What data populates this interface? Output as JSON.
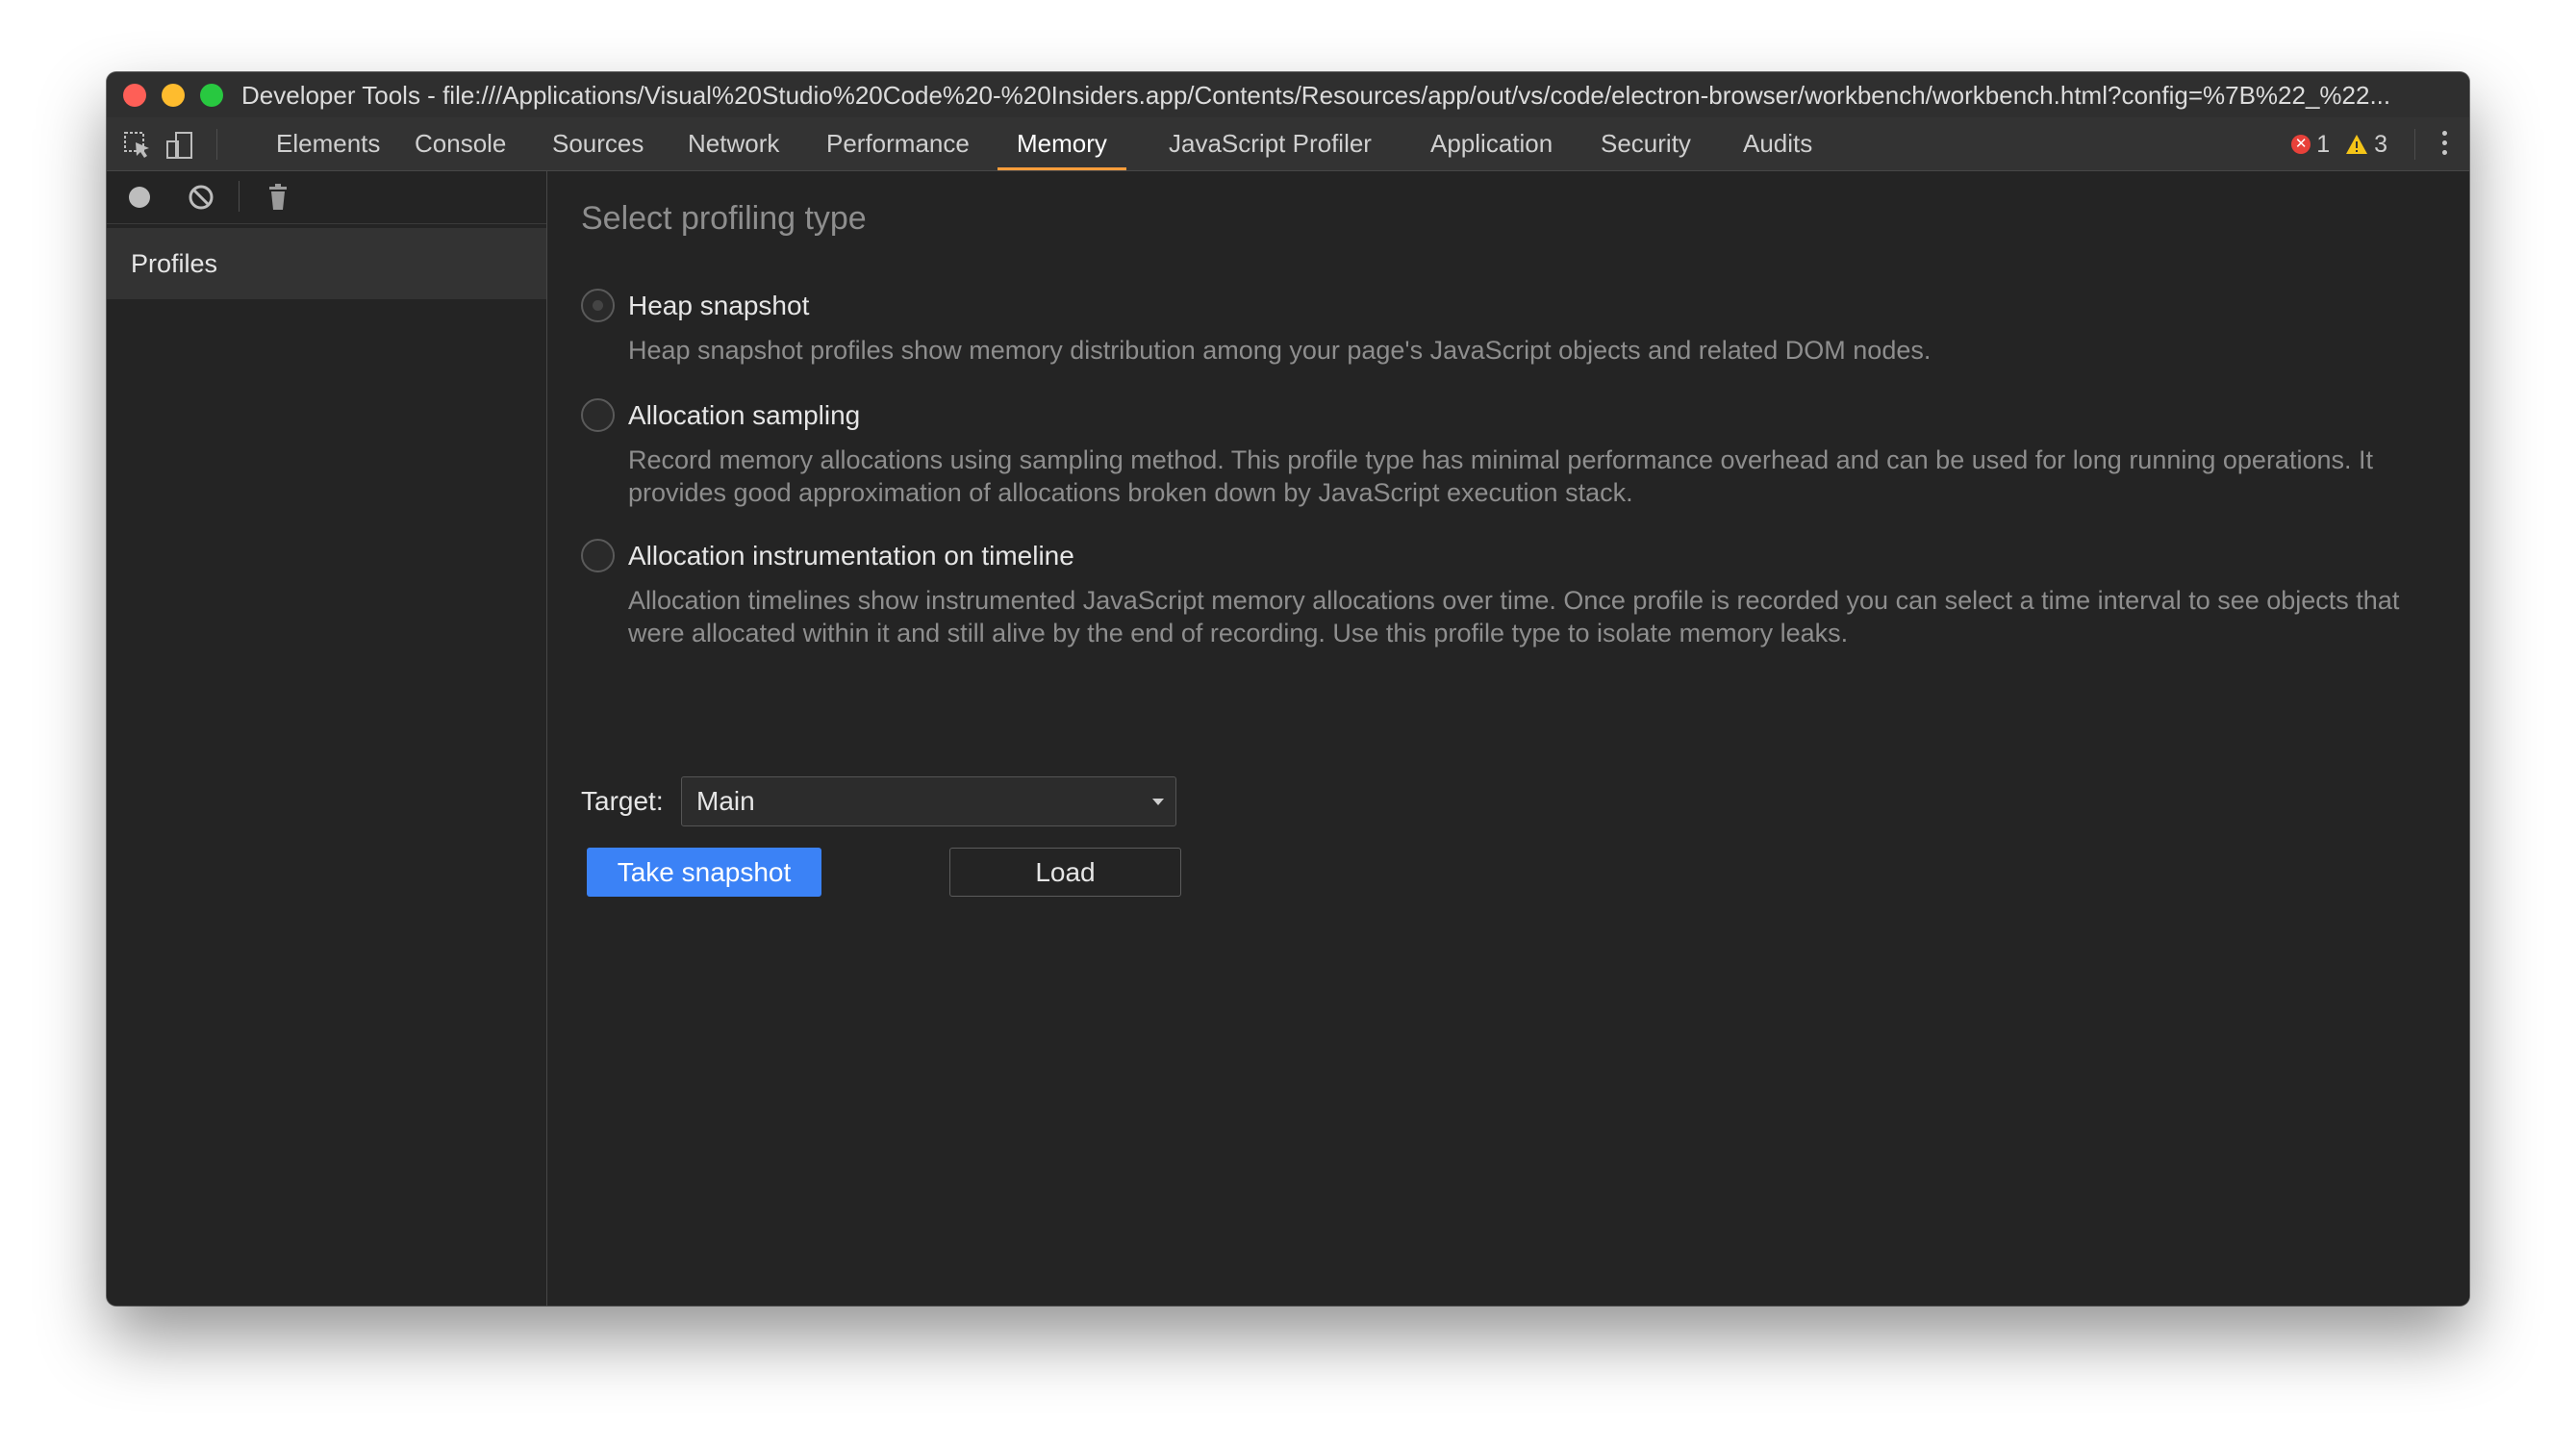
{
  "window": {
    "title": "Developer Tools - file:///Applications/Visual%20Studio%20Code%20-%20Insiders.app/Contents/Resources/app/out/vs/code/electron-browser/workbench/workbench.html?config=%7B%22_%22..."
  },
  "toolbar": {
    "icons": [
      "inspect-element-icon",
      "device-toolbar-icon"
    ],
    "tabs": [
      {
        "label": "Elements",
        "active": false
      },
      {
        "label": "Console",
        "active": false
      },
      {
        "label": "Sources",
        "active": false
      },
      {
        "label": "Network",
        "active": false
      },
      {
        "label": "Performance",
        "active": false
      },
      {
        "label": "Memory",
        "active": true
      },
      {
        "label": "JavaScript Profiler",
        "active": false
      },
      {
        "label": "Application",
        "active": false
      },
      {
        "label": "Security",
        "active": false
      },
      {
        "label": "Audits",
        "active": false
      }
    ],
    "error_count": "1",
    "warning_count": "3",
    "error_icon_glyph": "✕"
  },
  "sidebar": {
    "icons": [
      "record-icon",
      "clear-icon",
      "trash-icon"
    ],
    "profiles_label": "Profiles"
  },
  "main": {
    "section_title": "Select profiling type",
    "options": [
      {
        "label": "Heap snapshot",
        "description": "Heap snapshot profiles show memory distribution among your page's JavaScript objects and related DOM nodes.",
        "selected": true
      },
      {
        "label": "Allocation sampling",
        "description": "Record memory allocations using sampling method. This profile type has minimal performance overhead and can be used for long running operations. It provides good approximation of allocations broken down by JavaScript execution stack.",
        "selected": false
      },
      {
        "label": "Allocation instrumentation on timeline",
        "description": "Allocation timelines show instrumented JavaScript memory allocations over time. Once profile is recorded you can select a time interval to see objects that were allocated within it and still alive by the end of recording. Use this profile type to isolate memory leaks.",
        "selected": false
      }
    ],
    "target_label": "Target:",
    "target_value": "Main",
    "take_snapshot_label": "Take snapshot",
    "load_label": "Load"
  },
  "colors": {
    "accent_tab_underline": "#ff9d3b",
    "primary_button": "#3b82f6",
    "error": "#e8413a",
    "warning": "#f5c518"
  }
}
